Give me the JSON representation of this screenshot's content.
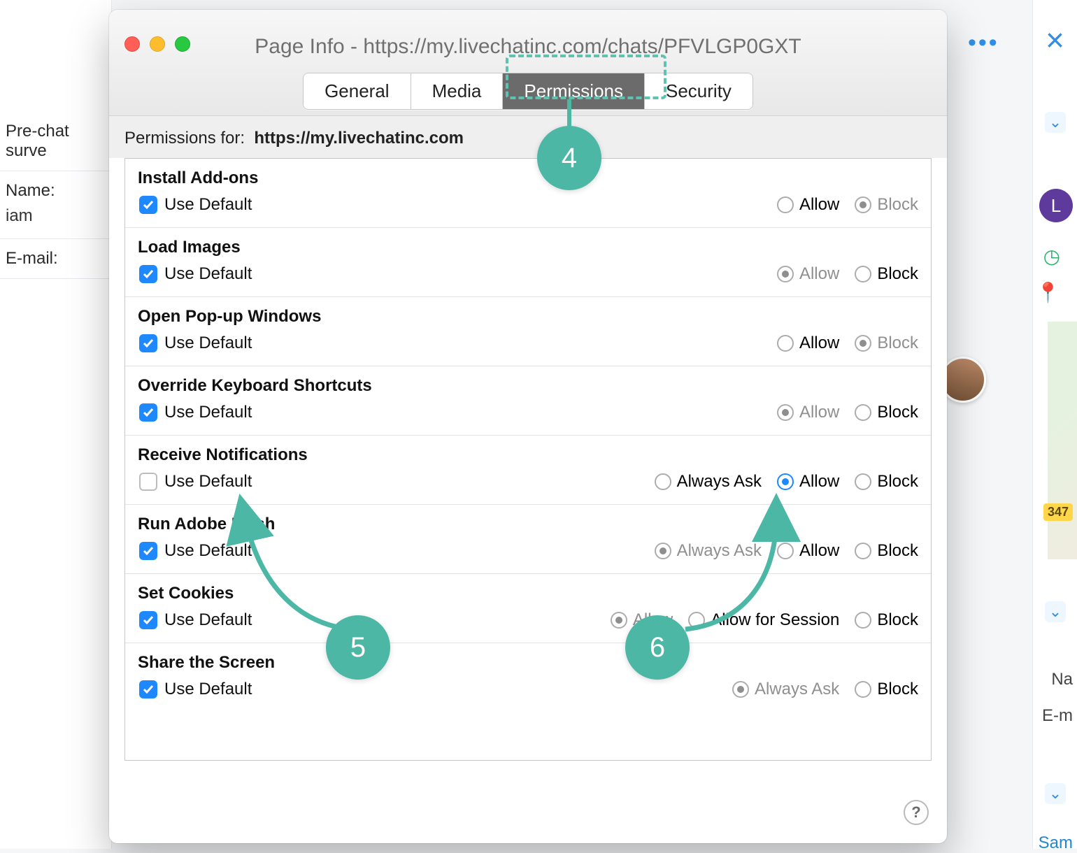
{
  "bg": {
    "prechat_survey": "Pre-chat surve",
    "name_label": "Name:",
    "name_value": "iam",
    "email_label": "E-mail:",
    "avatar_initial": "L",
    "badge": "347",
    "right_name_label": "Na",
    "right_email_label": "E-m",
    "sam_link": "Sam"
  },
  "window": {
    "title": "Page Info - https://my.livechatinc.com/chats/PFVLGP0GXT",
    "tabs": {
      "general": "General",
      "media": "Media",
      "permissions": "Permissions",
      "security": "Security"
    },
    "perm_for_label": "Permissions for:",
    "perm_for_url": "https://my.livechatinc.com",
    "help": "?",
    "rows": [
      {
        "title": "Install Add-ons",
        "use_default": true,
        "opts": [
          {
            "label": "Allow",
            "state": "off"
          },
          {
            "label": "Block",
            "state": "disabled-on"
          }
        ]
      },
      {
        "title": "Load Images",
        "use_default": true,
        "opts": [
          {
            "label": "Allow",
            "state": "disabled-on"
          },
          {
            "label": "Block",
            "state": "off"
          }
        ]
      },
      {
        "title": "Open Pop-up Windows",
        "use_default": true,
        "opts": [
          {
            "label": "Allow",
            "state": "off"
          },
          {
            "label": "Block",
            "state": "disabled-on"
          }
        ]
      },
      {
        "title": "Override Keyboard Shortcuts",
        "use_default": true,
        "opts": [
          {
            "label": "Allow",
            "state": "disabled-on"
          },
          {
            "label": "Block",
            "state": "off"
          }
        ]
      },
      {
        "title": "Receive Notifications",
        "use_default": false,
        "opts": [
          {
            "label": "Always Ask",
            "state": "off"
          },
          {
            "label": "Allow",
            "state": "selected"
          },
          {
            "label": "Block",
            "state": "off"
          }
        ]
      },
      {
        "title": "Run Adobe Flash",
        "use_default": true,
        "opts": [
          {
            "label": "Always Ask",
            "state": "disabled-on"
          },
          {
            "label": "Allow",
            "state": "off"
          },
          {
            "label": "Block",
            "state": "off"
          }
        ]
      },
      {
        "title": "Set Cookies",
        "use_default": true,
        "opts": [
          {
            "label": "Allow",
            "state": "disabled-on"
          },
          {
            "label": "Allow for Session",
            "state": "off"
          },
          {
            "label": "Block",
            "state": "off"
          }
        ]
      },
      {
        "title": "Share the Screen",
        "use_default": true,
        "opts": [
          {
            "label": "Always Ask",
            "state": "disabled-on"
          },
          {
            "label": "Block",
            "state": "off"
          }
        ]
      }
    ]
  },
  "annotations": {
    "n4": "4",
    "n5": "5",
    "n6": "6"
  }
}
